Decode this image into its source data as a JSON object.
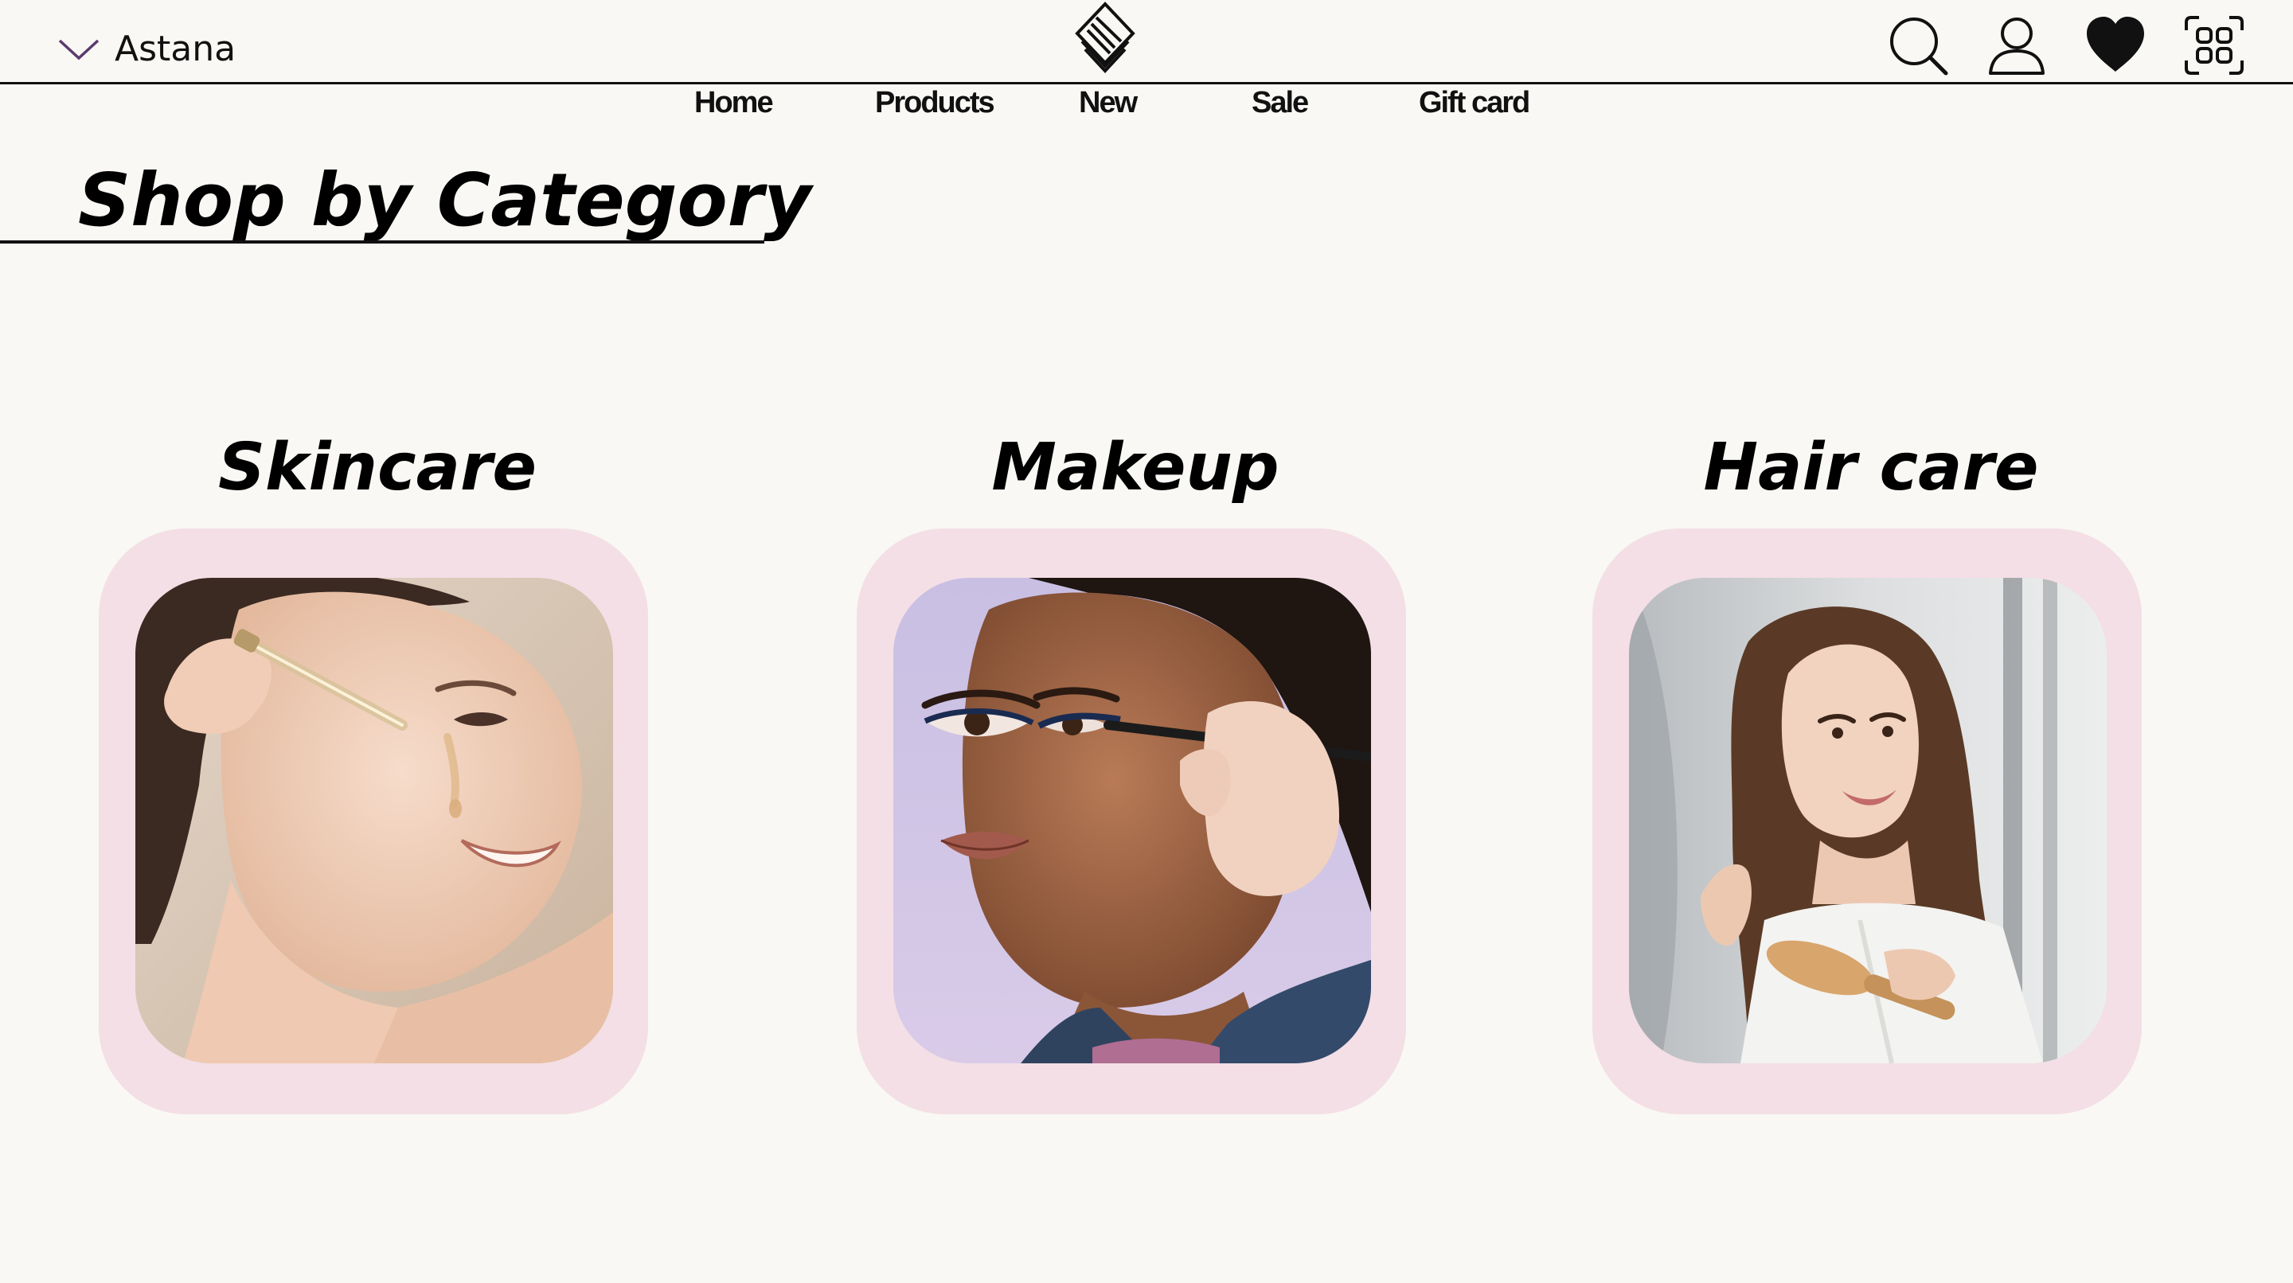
{
  "header": {
    "location": "Astana",
    "logo_icon": "stacked-diamond-logo",
    "icons": [
      "search-icon",
      "user-icon",
      "heart-icon",
      "grid-icon"
    ]
  },
  "nav": {
    "items": [
      {
        "label": "Home"
      },
      {
        "label": "Products"
      },
      {
        "label": "New"
      },
      {
        "label": "Sale"
      },
      {
        "label": "Gift card"
      }
    ]
  },
  "section": {
    "title": "Shop by Category"
  },
  "categories": [
    {
      "label": "Skincare",
      "image": "woman-applying-serum-dropper"
    },
    {
      "label": "Makeup",
      "image": "woman-applying-eyeliner"
    },
    {
      "label": "Hair care",
      "image": "woman-brushing-hair"
    }
  ],
  "colors": {
    "background": "#f9f8f4",
    "card_pink": "#f3dfe5",
    "text": "#111111",
    "chevron_purple": "#6a3d7a"
  }
}
